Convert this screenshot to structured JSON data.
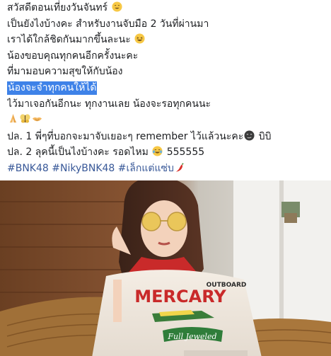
{
  "post": {
    "lines": [
      {
        "text": "สวัสดีตอนเที่ยงวันจันทร์",
        "emoji": "grin-smile-emoji"
      },
      {
        "text": "เป็นยังไงบ้างคะ สำหรับงานจับมือ 2 วันที่ผ่านมา"
      },
      {
        "text": "เราได้ใกล้ชิดกันมากขึ้นละนะ",
        "emoji": "laughing-emoji"
      },
      {
        "text": "น้องขอบคุณทุกคนอีกครั้งนะคะ"
      },
      {
        "text": "ที่มามอบความสุขให้กับน้อง"
      },
      {
        "text": "น้องจะจำทุกคนให้ได้",
        "highlighted": true
      },
      {
        "text": "ไว้มาเจอกันอีกนะ ทุกงานเลย น้องจะรอทุกคนนะ"
      },
      {
        "emojis": [
          "folded-hands-emoji",
          "butterfly-emoji",
          "handshake-emoji"
        ]
      },
      {
        "text": "ปล. 1 พี่ๆที่บอกจะมาจับเยอะๆ remember ไว้แล้วนะคะ",
        "emoji": "smirk-dark-emoji",
        "suffix": " บิบิ"
      },
      {
        "text": "ปล. 2 ลุคนี้เป็นไงบ้างคะ รอดไหม",
        "emoji": "tears-of-joy-emoji",
        "suffix": " 555555"
      }
    ],
    "hashtags": [
      "#BNK48",
      "#NikyBNK48",
      "#เล็กแต่แซ่บ"
    ],
    "hashtag_emoji": "chili-pepper-emoji"
  },
  "photo": {
    "description_icon": "portrait-photo"
  },
  "colors": {
    "text": "#1c1e21",
    "link": "#385898",
    "highlight": "#3e82e8"
  }
}
